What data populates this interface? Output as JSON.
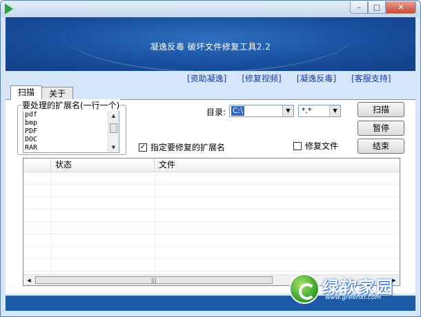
{
  "banner": {
    "title": "凝逸反毒 破坏文件修复工具2.2"
  },
  "links": [
    "[资助凝逸]",
    "[修复视频]",
    "[凝逸反毒]",
    "[客服支持]"
  ],
  "tabs": [
    "扫描",
    "关于"
  ],
  "extensions": {
    "label": "要处理的扩展名(一行一个)",
    "items": [
      "pdf",
      "bmp",
      "PDF",
      "DOC",
      "RAR"
    ]
  },
  "directory": {
    "label": "目录:",
    "value": "C:\\",
    "filter": "*.*"
  },
  "buttons": {
    "scan": "扫描",
    "pause": "暂停",
    "end": "结束"
  },
  "options": {
    "specify_ext": "指定要修复的扩展名",
    "specify_ext_checked": "✓",
    "repair_file": "修复文件"
  },
  "table": {
    "columns": [
      "",
      "状态",
      "文件"
    ]
  },
  "watermark": {
    "brand": "绿软家园",
    "url": "www.greenxf.com"
  },
  "colors": {
    "banner": "#184f9e",
    "link": "#1a3aa8",
    "selection": "#3168c6"
  },
  "window_buttons": {
    "minimize": "–",
    "maximize": "□",
    "close": "✕"
  }
}
